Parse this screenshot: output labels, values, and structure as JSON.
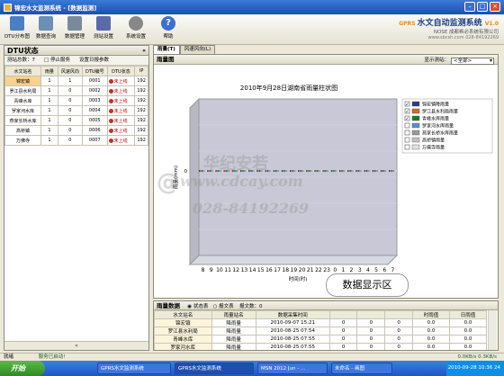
{
  "window": {
    "title": "锦宏水文监测系统 - [数据监测]"
  },
  "toolbar": {
    "items": [
      {
        "label": "DTU分布图",
        "color": "#4a7fc5"
      },
      {
        "label": "数据查询",
        "color": "#6b8fb5"
      },
      {
        "label": "数据管理",
        "color": "#7a8a9a"
      },
      {
        "label": "测站设置",
        "color": "#5a6aaa"
      },
      {
        "label": "系统设置",
        "color": "#888888"
      },
      {
        "label": "帮助",
        "color": "#3d6fd1"
      }
    ]
  },
  "brand": {
    "title": "水文自动监测系统",
    "version": "V1.0",
    "company": "NOSE 成都希必系统有限公司",
    "contact": "www.sbcsh.com 028-84192269"
  },
  "left_panel": {
    "title": "DTU状态",
    "count_label": "测站总数：7",
    "stop_button": "停止服务",
    "settings_button": "设置日报参数",
    "columns": [
      "水文站名",
      "雨量",
      "风速风向",
      "DTU编号",
      "DTU状态",
      "IP"
    ],
    "rows": [
      {
        "name": "锦宏镇",
        "rain": "1",
        "wind": "1",
        "dtu": "0001",
        "status": "未上线",
        "ip": "192"
      },
      {
        "name": "罗江县水利局",
        "rain": "1",
        "wind": "0",
        "dtu": "0002",
        "status": "未上线",
        "ip": "192"
      },
      {
        "name": "青峰水库",
        "rain": "1",
        "wind": "0",
        "dtu": "0003",
        "status": "未上线",
        "ip": "192"
      },
      {
        "name": "罗家河水库",
        "rain": "1",
        "wind": "0",
        "dtu": "0004",
        "status": "未上线",
        "ip": "192"
      },
      {
        "name": "燕家长桥水库",
        "rain": "1",
        "wind": "0",
        "dtu": "0005",
        "status": "未上线",
        "ip": "192"
      },
      {
        "name": "高桥镇",
        "rain": "1",
        "wind": "0",
        "dtu": "0006",
        "status": "未上线",
        "ip": "192"
      },
      {
        "name": "万佛寺",
        "rain": "1",
        "wind": "0",
        "dtu": "0007",
        "status": "未上线",
        "ip": "192"
      }
    ]
  },
  "tabs": [
    "雨量(T)",
    "风速风向(L)"
  ],
  "chart_panel": {
    "title": "雨量图",
    "display_label": "显示测站：",
    "display_value": "<全部>"
  },
  "chart_data": {
    "type": "bar",
    "title": "2010年9月28日湖南省雨量柱状图",
    "ylabel": "雨量(mm)",
    "xlabel": "时间(时)",
    "categories": [
      "8",
      "9",
      "10",
      "11",
      "12",
      "13",
      "14",
      "15",
      "16",
      "17",
      "18",
      "19",
      "20",
      "21",
      "22",
      "23",
      "0",
      "1",
      "2",
      "3",
      "4",
      "5",
      "6",
      "7"
    ],
    "ylim": [
      0,
      1
    ],
    "series": [
      {
        "name": "锦宏镇降雨量",
        "color": "#2b3a8c",
        "values": [
          0,
          0,
          0,
          0,
          0,
          0,
          0,
          0,
          0,
          0,
          0,
          0,
          0,
          0,
          0,
          0,
          0,
          0,
          0,
          0,
          0,
          0,
          0,
          0
        ]
      },
      {
        "name": "罗江县水利局雨量",
        "color": "#d46a1e",
        "values": [
          0,
          0,
          0,
          0,
          0,
          0,
          0,
          0,
          0,
          0,
          0,
          0,
          0,
          0,
          0,
          0,
          0,
          0,
          0,
          0,
          0,
          0,
          0,
          0
        ]
      },
      {
        "name": "青峰水库雨量",
        "color": "#1c7a2a",
        "values": [
          0,
          0,
          0,
          0,
          0,
          0,
          0,
          0,
          0,
          0,
          0,
          0,
          0,
          0,
          0,
          0,
          0,
          0,
          0,
          0,
          0,
          0,
          0,
          0
        ]
      },
      {
        "name": "罗家河水库雨量",
        "color": "#5a8ed4",
        "values": [
          0,
          0,
          0,
          0,
          0,
          0,
          0,
          0,
          0,
          0,
          0,
          0,
          0,
          0,
          0,
          0,
          0,
          0,
          0,
          0,
          0,
          0,
          0,
          0
        ]
      },
      {
        "name": "燕家长桥水库雨量",
        "color": "#9a9a9a",
        "values": [
          0,
          0,
          0,
          0,
          0,
          0,
          0,
          0,
          0,
          0,
          0,
          0,
          0,
          0,
          0,
          0,
          0,
          0,
          0,
          0,
          0,
          0,
          0,
          0
        ]
      },
      {
        "name": "高桥镇雨量",
        "color": "#c2c2c2",
        "values": [
          0,
          0,
          0,
          0,
          0,
          0,
          0,
          0,
          0,
          0,
          0,
          0,
          0,
          0,
          0,
          0,
          0,
          0,
          0,
          0,
          0,
          0,
          0,
          0
        ]
      },
      {
        "name": "万佛寺雨量",
        "color": "#e0e0e0",
        "values": [
          0,
          0,
          0,
          0,
          0,
          0,
          0,
          0,
          0,
          0,
          0,
          0,
          0,
          0,
          0,
          0,
          0,
          0,
          0,
          0,
          0,
          0,
          0,
          0
        ]
      }
    ],
    "y_tick": "0",
    "grid": true,
    "legend": "right"
  },
  "data_panel": {
    "title": "雨量数据",
    "radio1": "状态表",
    "radio2": "报文表",
    "info_label": "报文数：0",
    "callout": "数据显示区",
    "columns": [
      "水文站名",
      "雨量站名",
      "数据采集时间",
      "",
      "",
      "",
      "时雨值",
      "日雨值"
    ],
    "rows": [
      {
        "station": "锦宏镇",
        "type": "降雨量",
        "time": "2010-09-07 15:21",
        "c1": "0",
        "c2": "0",
        "c3": "0",
        "hour": "0.0",
        "day": "0.0"
      },
      {
        "station": "罗江县水利局",
        "type": "降雨量",
        "time": "2010-08-25 07:54",
        "c1": "0",
        "c2": "0",
        "c3": "0",
        "hour": "0.0",
        "day": "0.0"
      },
      {
        "station": "青峰水库",
        "type": "降雨量",
        "time": "2010-08-25 07:55",
        "c1": "0",
        "c2": "0",
        "c3": "0",
        "hour": "0.0",
        "day": "0.0"
      },
      {
        "station": "罗家河水库",
        "type": "降雨量",
        "time": "2010-08-25 07:55",
        "c1": "0",
        "c2": "0",
        "c3": "0",
        "hour": "0.0",
        "day": "0.0"
      },
      {
        "station": "燕家长桥水库",
        "type": "降雨量",
        "time": "2010-08-25 07:55",
        "c1": "0",
        "c2": "0",
        "c3": "0",
        "hour": "0.0",
        "day": "0.0"
      },
      {
        "station": "高桥镇",
        "type": "降雨量",
        "time": "2010-08-25 07:55",
        "c1": "0",
        "c2": "0",
        "c3": "0",
        "hour": "0.0",
        "day": "0.0"
      }
    ]
  },
  "status": {
    "left": "就绪",
    "service": "服务已启动!",
    "net": "0.0KB/s  0.3KB/s"
  },
  "taskbar": {
    "start": "开始",
    "tasks": [
      "GPRS水文监测系统",
      "GPRS水文监测系统",
      "MSN 2012 Jun - ...",
      "未命名 - 画图"
    ],
    "clock": "2010-09-28 10:36 24"
  },
  "watermark": {
    "line1": "华纪安若",
    "line2": "www.cdcay.com",
    "line3": "028-84192269"
  }
}
